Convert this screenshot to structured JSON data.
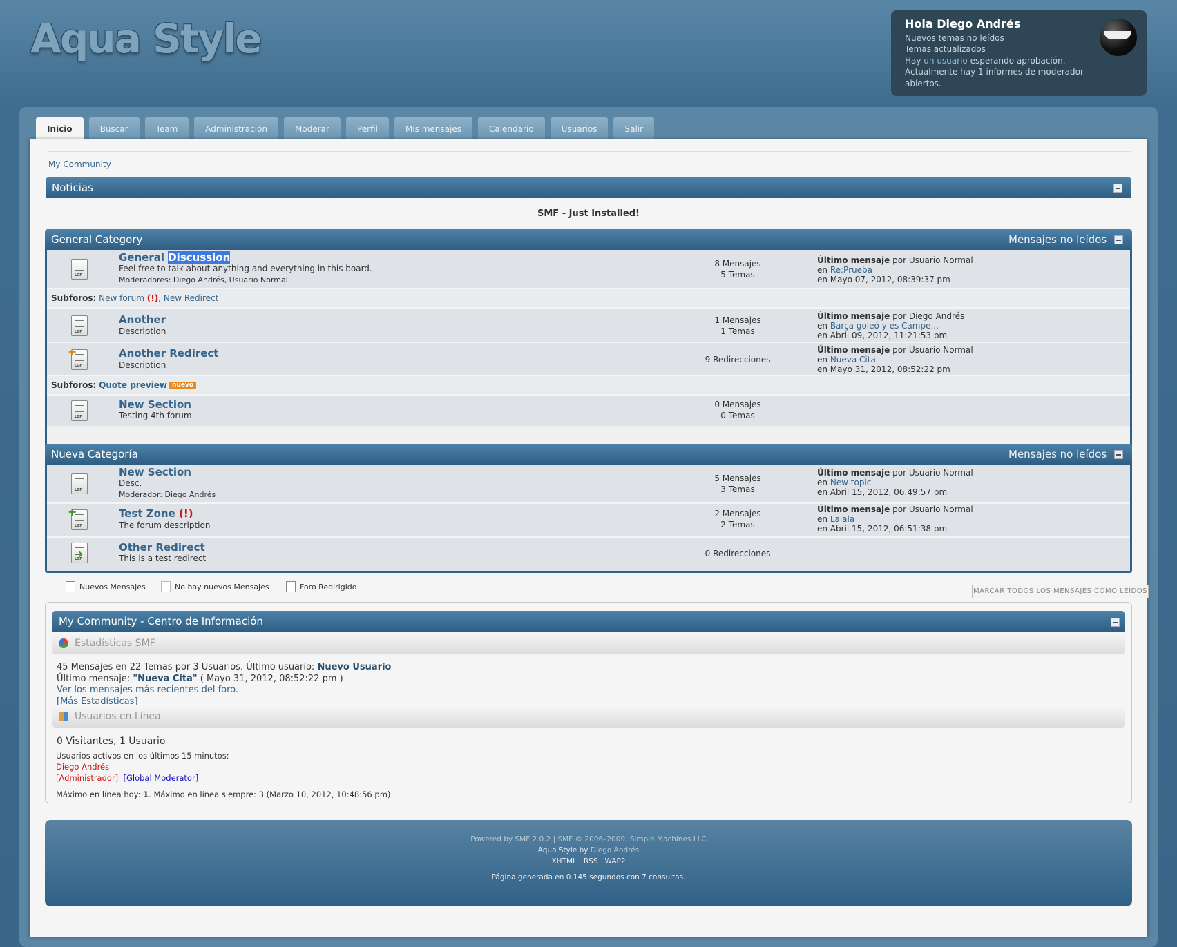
{
  "header": {
    "logo_text": "Aqua Style",
    "user": {
      "greeting": "Hola Diego Andrés",
      "lines": [
        "Nuevos temas no leídos",
        "Temas actualizados"
      ],
      "approval_prefix": "Hay ",
      "approval_link": "un usuario",
      "approval_suffix": " esperando aprobación.",
      "reports_line1": "Actualmente hay 1 informes de moderador",
      "reports_line2": "abiertos."
    }
  },
  "tabs": [
    "Inicio",
    "Buscar",
    "Team",
    "Administración",
    "Moderar",
    "Perfil",
    "Mis mensajes",
    "Calendario",
    "Usuarios",
    "Salir"
  ],
  "breadcrumb": "My Community",
  "news": {
    "title": "Noticias",
    "text": "SMF - Just Installed!"
  },
  "categories": [
    {
      "name": "General Category",
      "unread_label": "Mensajes no leídos",
      "boards": [
        {
          "name_part1": "General",
          "name_part2": "Discussion",
          "description": "Feel free to talk about anything and everything in this board.",
          "moderators": "Moderadores: Diego Andrés, Usuario Normal",
          "stats1": "8 Mensajes",
          "stats2": "5 Temas",
          "last_label": "Último mensaje",
          "last_by": " por Usuario Normal",
          "last_in_prefix": "en ",
          "last_in": "Re:Prueba",
          "last_date": "en Mayo 07, 2012, 08:39:37 pm",
          "subforums_label": "Subforos:",
          "subforum1": "New forum",
          "subforum1_mark": "(!)",
          "subforum2": "New Redirect"
        },
        {
          "name": "Another",
          "description": "Description",
          "stats1": "1 Mensajes",
          "stats2": "1 Temas",
          "last_label": "Último mensaje",
          "last_by": " por Diego Andrés",
          "last_in_prefix": "en ",
          "last_in": "Barça goleó y es Campe...",
          "last_date": "en Abril 09, 2012, 11:21:53 pm"
        },
        {
          "name": "Another Redirect",
          "description": "Description",
          "stats1": "9 Redirecciones",
          "last_label": "Último mensaje",
          "last_by": " por Usuario Normal",
          "last_in_prefix": "en ",
          "last_in": "Nueva Cita",
          "last_date": "en Mayo 31, 2012, 08:52:22 pm",
          "subforums_label": "Subforos:",
          "subforum1": "Quote preview",
          "badge": "nuevo"
        },
        {
          "name": "New Section",
          "description": "Testing 4th forum",
          "stats1": "0 Mensajes",
          "stats2": "0 Temas"
        }
      ]
    },
    {
      "name": "Nueva Categoría",
      "unread_label": "Mensajes no leídos",
      "boards": [
        {
          "name": "New Section",
          "description": "Desc.",
          "moderators": "Moderador: Diego Andrés",
          "stats1": "5 Mensajes",
          "stats2": "3 Temas",
          "last_label": "Último mensaje",
          "last_by": " por Usuario Normal",
          "last_in_prefix": "en ",
          "last_in": "New topic",
          "last_date": "en Abril 15, 2012, 06:49:57 pm"
        },
        {
          "name": "Test Zone",
          "name_mark": "(!)",
          "description": "The forum description",
          "stats1": "2 Mensajes",
          "stats2": "2 Temas",
          "last_label": "Último mensaje",
          "last_by": " por Usuario Normal",
          "last_in_prefix": "en ",
          "last_in": "Lalala",
          "last_date": "en Abril 15, 2012, 06:51:38 pm"
        },
        {
          "name": "Other Redirect",
          "description": "This is a test redirect",
          "stats1": "0 Redirecciones"
        }
      ]
    }
  ],
  "legend": [
    "Nuevos Mensajes",
    "No hay nuevos Mensajes",
    "Foro Redirigido"
  ],
  "mark_all_read": "MARCAR TODOS LOS MENSAJES COMO LEÍDOS",
  "info_center": {
    "title": "My Community - Centro de Información",
    "stats_title": "Estadísticas SMF",
    "stats_line1_prefix": "45 Mensajes en 22 Temas por 3 Usuarios. Último usuario: ",
    "stats_line1_user": "Nuevo Usuario",
    "stats_line2_prefix": "Último mensaje: ",
    "stats_line2_post": "\"Nueva Cita\"",
    "stats_line2_date": " ( Mayo 31, 2012, 08:52:22 pm )",
    "stats_line3": "Ver los mensajes más recientes del foro.",
    "stats_line4": "[Más Estadísticas]",
    "online_title": "Usuarios en Línea",
    "online_count": "0 Visitantes, 1 Usuario",
    "online_active": "Usuarios activos en los últimos 15 minutos:",
    "online_user": "Diego Andrés",
    "group_admin": "[Administrador]",
    "group_gmod": "[Global Moderator]",
    "max_prefix": "Máximo en línea hoy: ",
    "max_today": "1",
    "max_suffix": ". Máximo en línea siempre: 3 (Marzo 10, 2012, 10:48:56 pm)"
  },
  "footer": {
    "line1": "Powered by SMF 2.0.2 | SMF © 2006–2009, Simple Machines LLC",
    "line2_prefix": "Aqua Style by ",
    "line2_author": "Diego Andrés",
    "links": [
      "XHTML",
      "RSS",
      "WAP2"
    ],
    "line4": "Página generada en 0.145 segundos con 7 consultas."
  }
}
